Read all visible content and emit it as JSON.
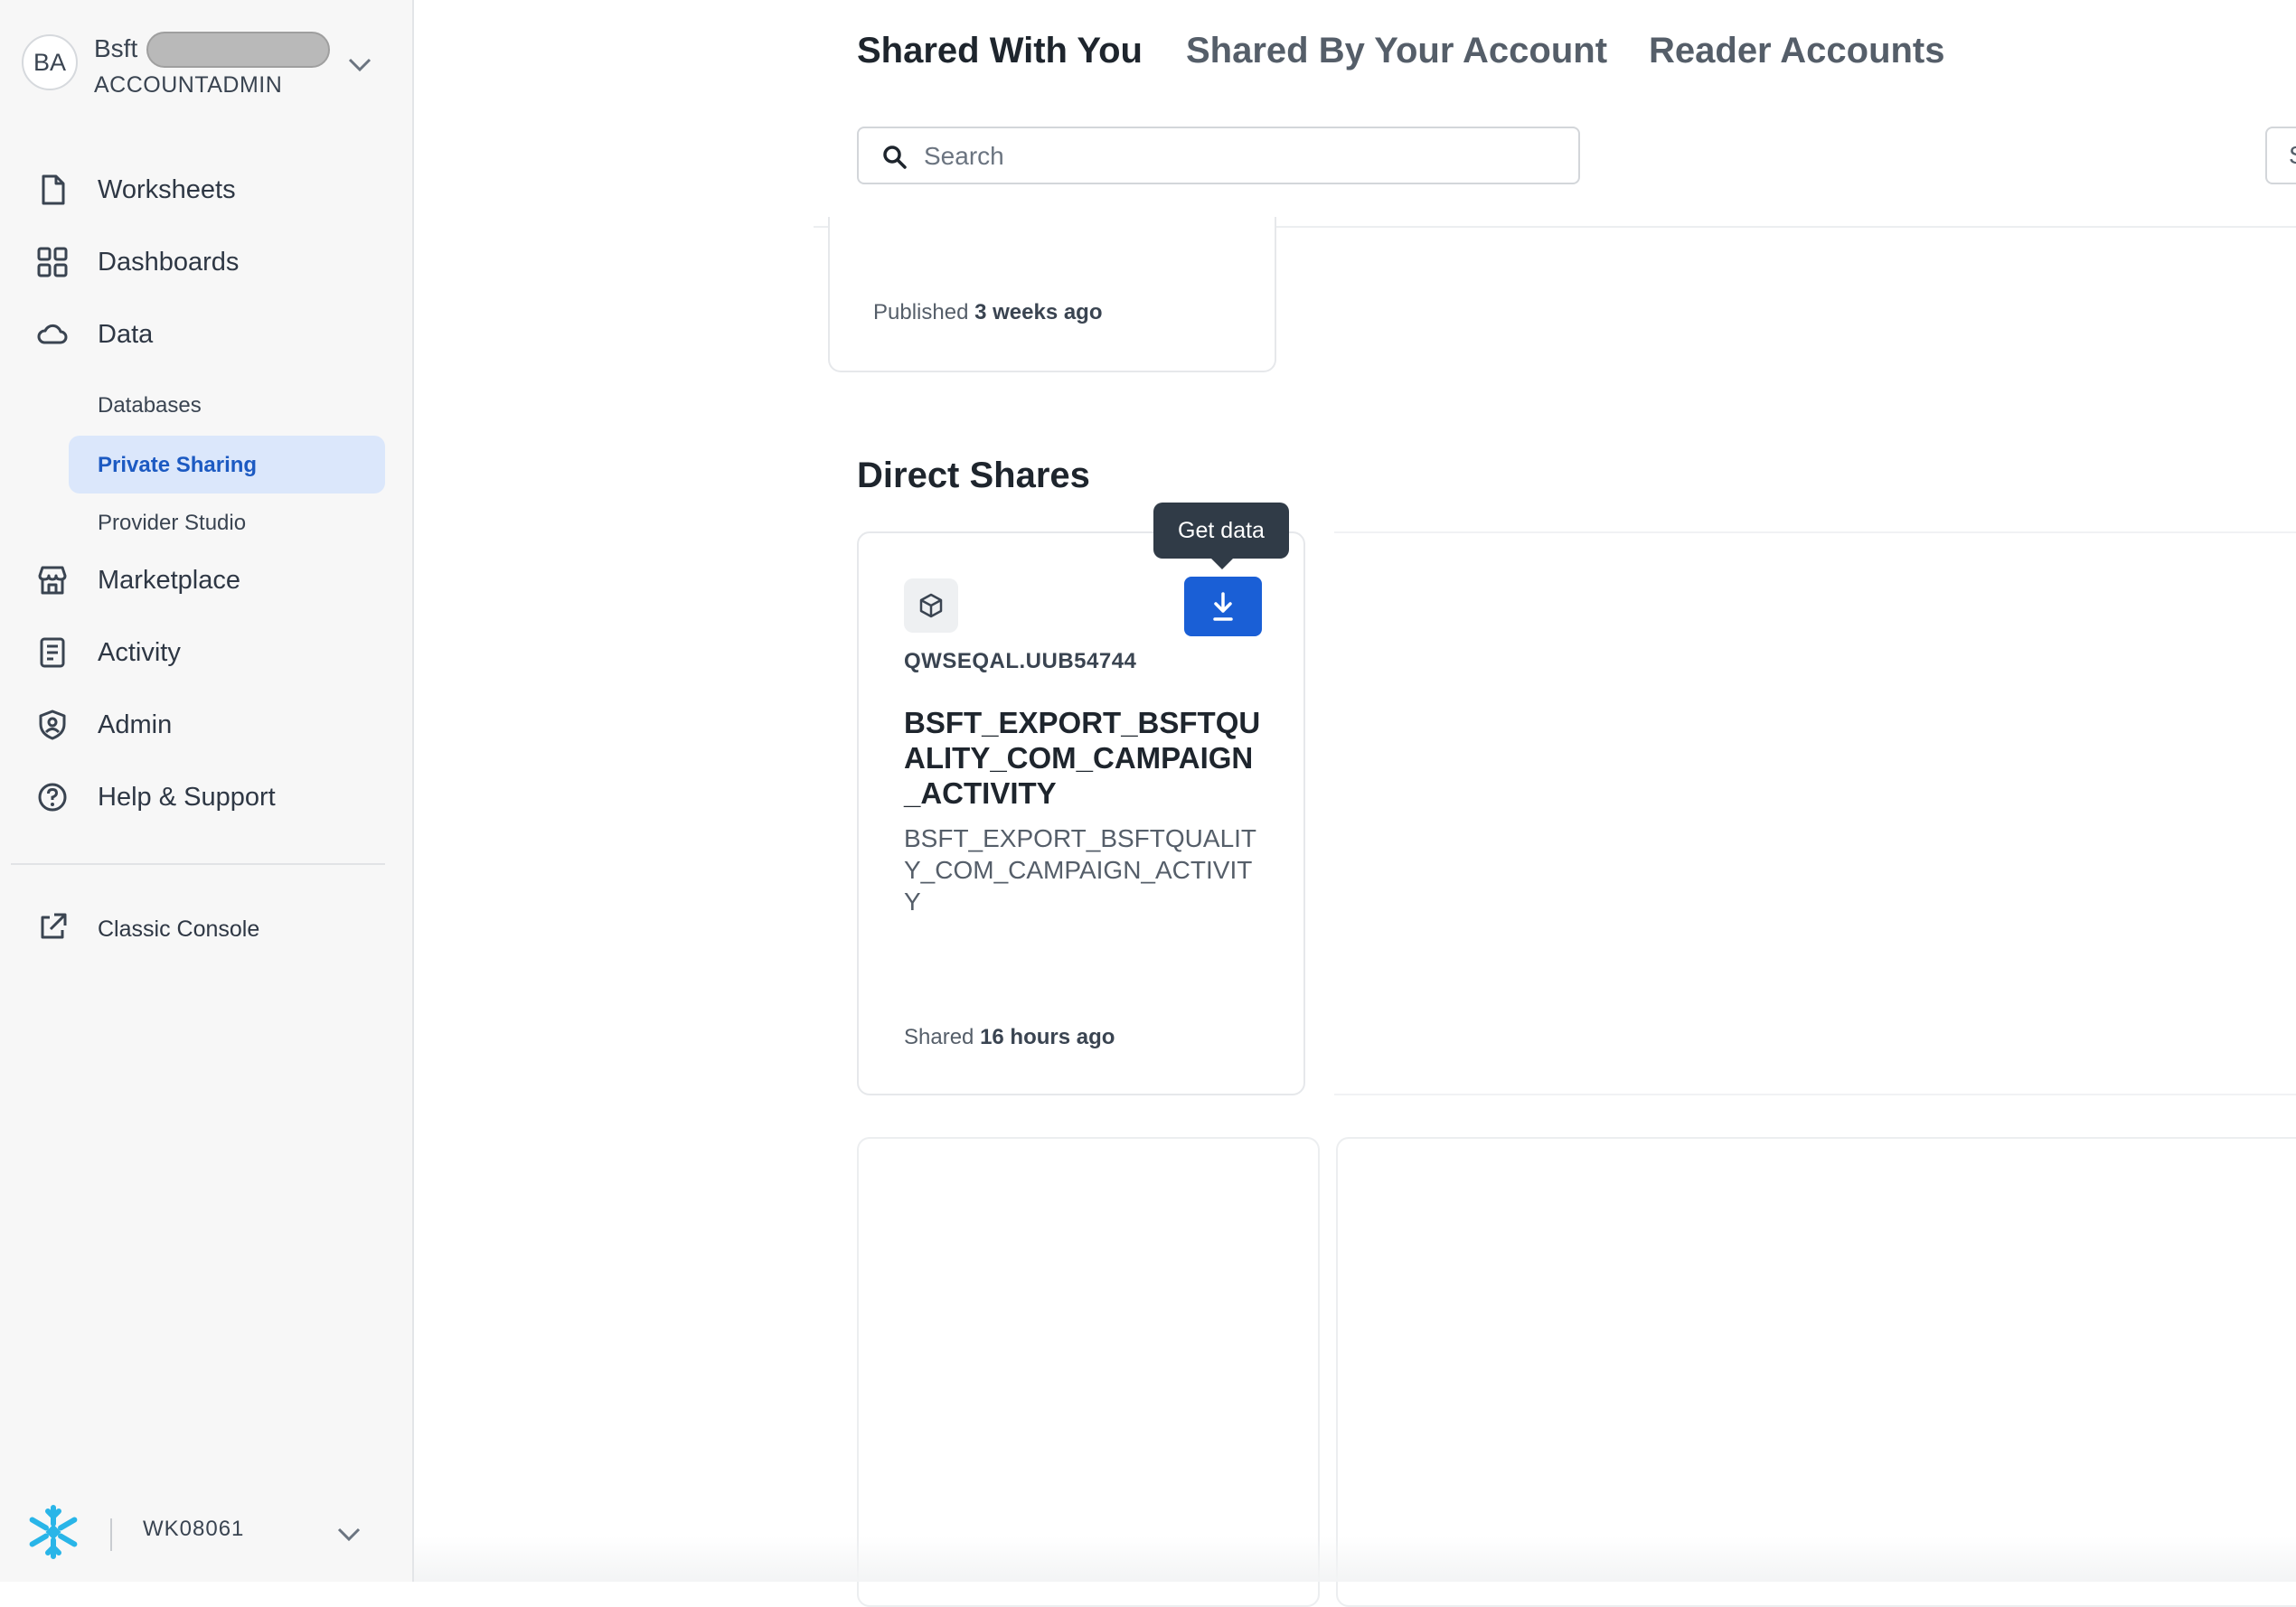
{
  "account": {
    "initials": "BA",
    "name_prefix": "Bsft",
    "role": "ACCOUNTADMIN"
  },
  "nav": {
    "worksheets": "Worksheets",
    "dashboards": "Dashboards",
    "data": "Data",
    "databases": "Databases",
    "private_sharing": "Private Sharing",
    "provider_studio": "Provider Studio",
    "marketplace": "Marketplace",
    "activity": "Activity",
    "admin": "Admin",
    "help": "Help & Support",
    "classic_console": "Classic Console"
  },
  "warehouse": {
    "name": "WK08061"
  },
  "tabs": {
    "shared_with_you": "Shared With You",
    "shared_by_account": "Shared By Your Account",
    "reader_accounts": "Reader Accounts"
  },
  "search": {
    "placeholder": "Search",
    "edge_letter": "S"
  },
  "top_card": {
    "published_label": "Published",
    "published_time": "3 weeks ago"
  },
  "direct_shares": {
    "title": "Direct Shares",
    "tooltip": "Get data",
    "card": {
      "owner": "QWSEQAL.UUB54744",
      "title": "BSFT_EXPORT_BSFTQUALITY_COM_CAMPAIGN_ACTIVITY",
      "description": "BSFT_EXPORT_BSFTQUALITY_COM_CAMPAIGN_ACTIVITY",
      "shared_label": "Shared",
      "shared_time": "16 hours ago"
    }
  },
  "colors": {
    "accent": "#1a5fd6",
    "active_nav_bg": "#dbe7fb",
    "active_nav_text": "#1c5ac2"
  },
  "icons": {
    "worksheets": "document-icon",
    "dashboards": "grid-icon",
    "data": "cloud-icon",
    "marketplace": "store-icon",
    "activity": "list-icon",
    "admin": "shield-icon",
    "help": "question-icon",
    "classic": "external-link-icon",
    "share": "cube-icon",
    "get": "download-icon"
  }
}
